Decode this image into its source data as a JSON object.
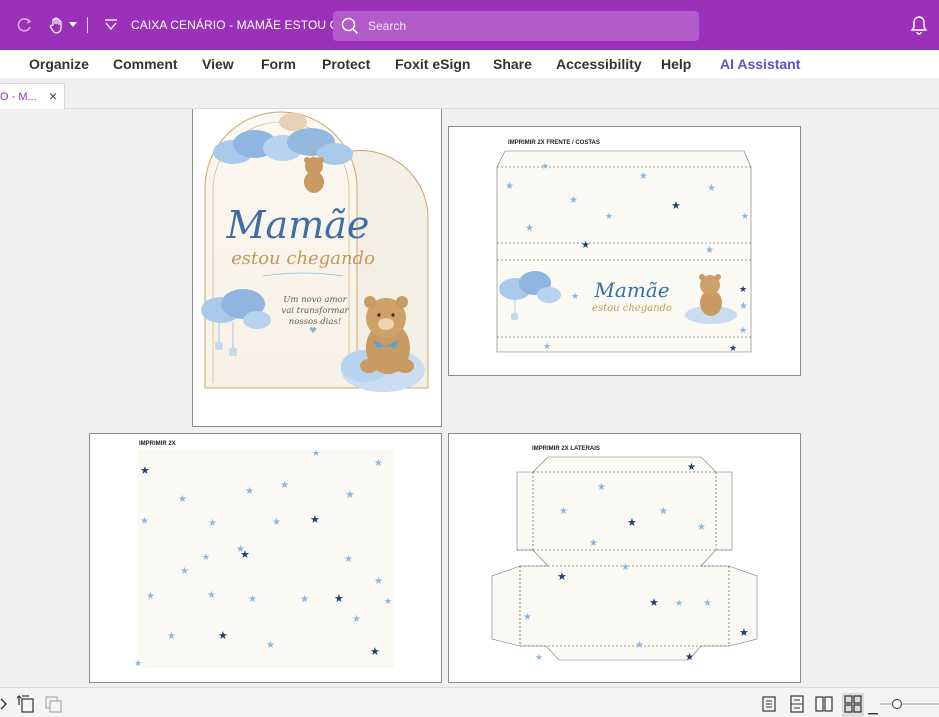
{
  "titlebar": {
    "doc_title": "CAIXA CENÁRIO - MAMÃE ESTOU CH...",
    "search_placeholder": "Search",
    "icons": [
      "redo-icon",
      "hand-tool-icon",
      "dropdown-icon",
      "quick-access-dropdown-icon",
      "search-icon",
      "notification-bell-icon"
    ]
  },
  "menu": {
    "items": [
      "Organize",
      "Comment",
      "View",
      "Form",
      "Protect",
      "Foxit eSign",
      "Share",
      "Accessibility",
      "Help"
    ],
    "ai_assistant": "AI Assistant"
  },
  "tab": {
    "label": "O - M...",
    "close": "×"
  },
  "pages": {
    "page1": {
      "title_line1": "Mamãe",
      "title_line2": "estou chegando",
      "message": [
        "Um novo amor",
        "vai transformar",
        "nossos dias!"
      ]
    },
    "page2": {
      "label": "IMPRIMIR 2X FRENTE / COSTAS",
      "title_line1": "Mamãe",
      "title_line2": "estou chegando"
    },
    "page3": {
      "label": "IMPRIMIR 2X"
    },
    "page4": {
      "label": "IMPRIMIR 2X LATERAIS"
    }
  },
  "colors": {
    "brand_purple": "#9b30b9",
    "search_bg": "#b25ccb",
    "ai_accent": "#5b54c9",
    "title_blue": "#3d6ea8",
    "script_gold": "#c49a5a",
    "star_light": "#8ab8e0",
    "star_dark": "#1f3f6e"
  },
  "statusbar": {
    "icons": [
      "expand-icon",
      "extract-page-icon",
      "copy-page-icon",
      "single-page-view-icon",
      "continuous-view-icon",
      "facing-view-icon",
      "two-page-continuous-view-icon",
      "zoom-out-icon",
      "zoom-slider"
    ]
  }
}
